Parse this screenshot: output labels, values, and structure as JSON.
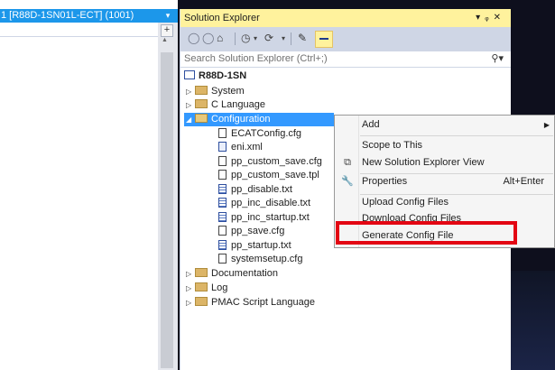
{
  "left_pane": {
    "tab_title": "1 [R88D-1SN01L-ECT] (1001)"
  },
  "solution_explorer": {
    "title": "Solution Explorer",
    "title_icons": [
      "pin-icon",
      "window-menu-icon",
      "close-icon"
    ],
    "title_icon_glyphs": {
      "menu": "▾",
      "pin": "ᵩ",
      "close": "✕"
    },
    "search_placeholder": "Search Solution Explorer (Ctrl+;)",
    "root": "R88D-1SN",
    "tree": {
      "system": "System",
      "c_language": "C Language",
      "configuration": "Configuration",
      "files": [
        {
          "name": "ECATConfig.cfg",
          "icon": "file-icon"
        },
        {
          "name": "eni.xml",
          "icon": "xml-file-icon"
        },
        {
          "name": "pp_custom_save.cfg",
          "icon": "file-icon"
        },
        {
          "name": "pp_custom_save.tpl",
          "icon": "file-icon"
        },
        {
          "name": "pp_disable.txt",
          "icon": "text-file-icon"
        },
        {
          "name": "pp_inc_disable.txt",
          "icon": "text-file-icon"
        },
        {
          "name": "pp_inc_startup.txt",
          "icon": "text-file-icon"
        },
        {
          "name": "pp_save.cfg",
          "icon": "file-icon"
        },
        {
          "name": "pp_startup.txt",
          "icon": "text-file-icon"
        },
        {
          "name": "systemsetup.cfg",
          "icon": "file-icon"
        }
      ],
      "documentation": "Documentation",
      "log": "Log",
      "pmac_script": "PMAC Script Language"
    }
  },
  "context_menu": {
    "add": "Add",
    "scope_to_this": "Scope to This",
    "new_view": "New Solution Explorer View",
    "properties": "Properties",
    "properties_shortcut": "Alt+Enter",
    "upload": "Upload Config Files",
    "download": "Download Config Files",
    "generate": "Generate Config File"
  },
  "colors": {
    "accent_blue": "#1c97ea",
    "title_yellow": "#fff29d",
    "selection": "#3399ff",
    "highlight_red": "#e30613"
  }
}
